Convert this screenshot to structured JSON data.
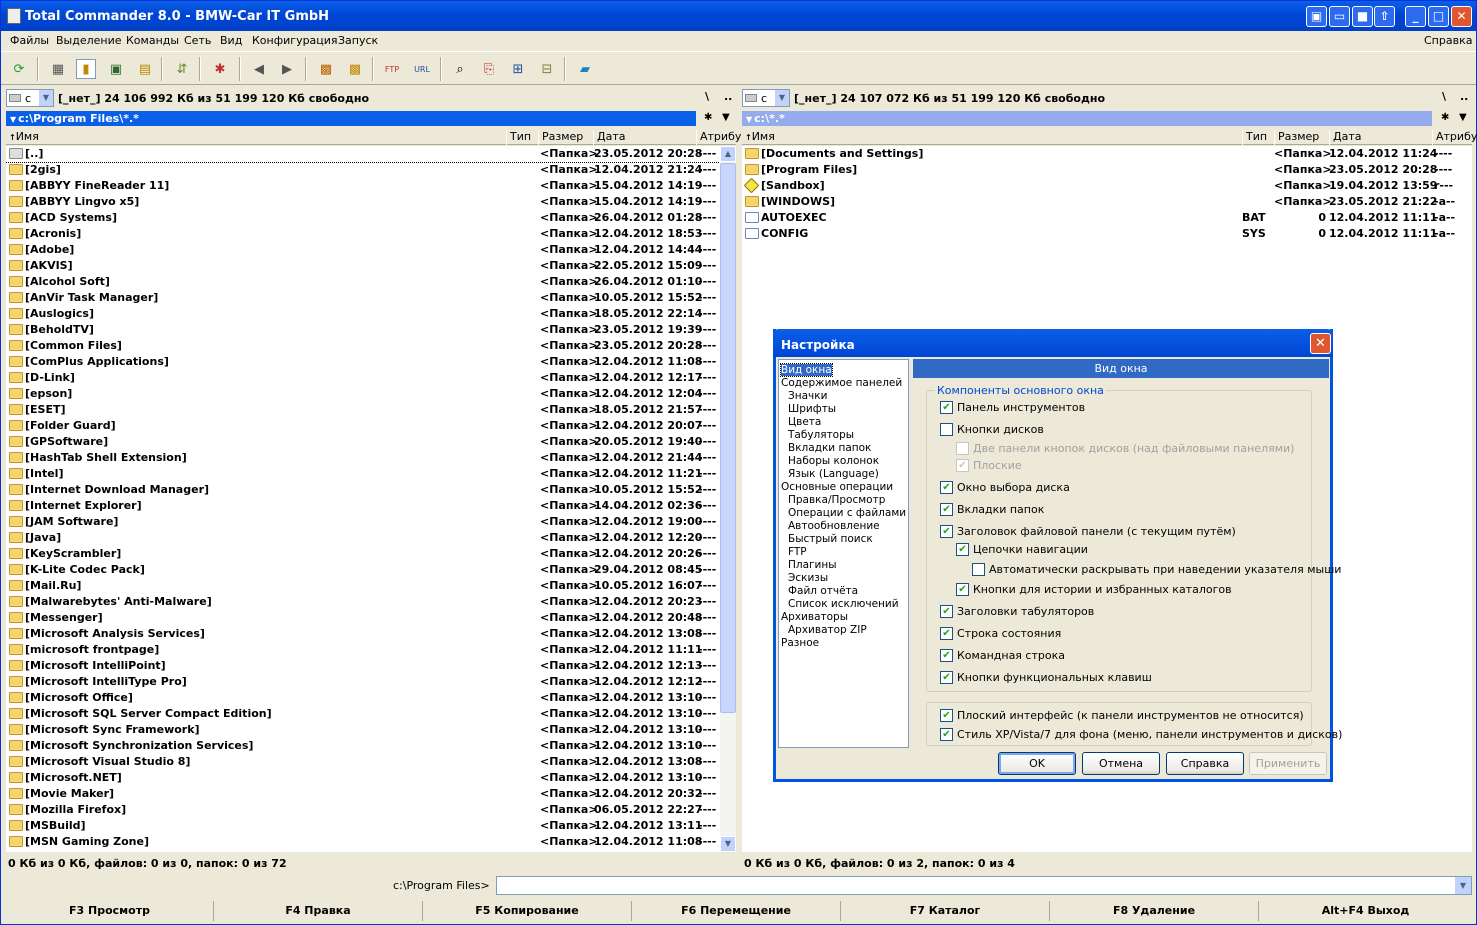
{
  "window": {
    "title": "Total Commander 8.0 - BMW-Car IT GmbH"
  },
  "menu": {
    "items": [
      "Файлы",
      "Выделение",
      "Команды",
      "Сеть",
      "Вид",
      "Конфигурация",
      "Запуск"
    ],
    "help": "Справка"
  },
  "left": {
    "drive": "c",
    "drive_info": "[_нет_]  24 106 992 Кб из 51 199 120 Кб свободно",
    "path": "c:\\Program Files\\*.*",
    "columns": [
      "Имя",
      "Тип",
      "Размер",
      "Дата",
      "Атрибу"
    ],
    "files": [
      {
        "name": "[..]",
        "size": "<Папка>",
        "date": "23.05.2012 20:28",
        "attr": "----"
      },
      {
        "name": "[2gis]",
        "size": "<Папка>",
        "date": "12.04.2012 21:24",
        "attr": "----"
      },
      {
        "name": "[ABBYY FineReader 11]",
        "size": "<Папка>",
        "date": "15.04.2012 14:19",
        "attr": "----"
      },
      {
        "name": "[ABBYY Lingvo x5]",
        "size": "<Папка>",
        "date": "15.04.2012 14:19",
        "attr": "----"
      },
      {
        "name": "[ACD Systems]",
        "size": "<Папка>",
        "date": "26.04.2012 01:28",
        "attr": "----"
      },
      {
        "name": "[Acronis]",
        "size": "<Папка>",
        "date": "12.04.2012 18:53",
        "attr": "----"
      },
      {
        "name": "[Adobe]",
        "size": "<Папка>",
        "date": "12.04.2012 14:44",
        "attr": "----"
      },
      {
        "name": "[AKVIS]",
        "size": "<Папка>",
        "date": "22.05.2012 15:09",
        "attr": "----"
      },
      {
        "name": "[Alcohol Soft]",
        "size": "<Папка>",
        "date": "26.04.2012 01:10",
        "attr": "----"
      },
      {
        "name": "[AnVir Task Manager]",
        "size": "<Папка>",
        "date": "10.05.2012 15:52",
        "attr": "----"
      },
      {
        "name": "[Auslogics]",
        "size": "<Папка>",
        "date": "18.05.2012 22:14",
        "attr": "----"
      },
      {
        "name": "[BeholdTV]",
        "size": "<Папка>",
        "date": "23.05.2012 19:39",
        "attr": "----"
      },
      {
        "name": "[Common Files]",
        "size": "<Папка>",
        "date": "23.05.2012 20:28",
        "attr": "----"
      },
      {
        "name": "[ComPlus Applications]",
        "size": "<Папка>",
        "date": "12.04.2012 11:08",
        "attr": "----"
      },
      {
        "name": "[D-Link]",
        "size": "<Папка>",
        "date": "12.04.2012 12:17",
        "attr": "----"
      },
      {
        "name": "[epson]",
        "size": "<Папка>",
        "date": "12.04.2012 12:04",
        "attr": "----"
      },
      {
        "name": "[ESET]",
        "size": "<Папка>",
        "date": "18.05.2012 21:57",
        "attr": "----"
      },
      {
        "name": "[Folder Guard]",
        "size": "<Папка>",
        "date": "12.04.2012 20:07",
        "attr": "----"
      },
      {
        "name": "[GPSoftware]",
        "size": "<Папка>",
        "date": "20.05.2012 19:40",
        "attr": "----"
      },
      {
        "name": "[HashTab Shell Extension]",
        "size": "<Папка>",
        "date": "12.04.2012 21:44",
        "attr": "----"
      },
      {
        "name": "[Intel]",
        "size": "<Папка>",
        "date": "12.04.2012 11:21",
        "attr": "----"
      },
      {
        "name": "[Internet Download Manager]",
        "size": "<Папка>",
        "date": "10.05.2012 15:52",
        "attr": "----"
      },
      {
        "name": "[Internet Explorer]",
        "size": "<Папка>",
        "date": "14.04.2012 02:36",
        "attr": "----"
      },
      {
        "name": "[JAM Software]",
        "size": "<Папка>",
        "date": "12.04.2012 19:00",
        "attr": "----"
      },
      {
        "name": "[Java]",
        "size": "<Папка>",
        "date": "12.04.2012 12:20",
        "attr": "----"
      },
      {
        "name": "[KeyScrambler]",
        "size": "<Папка>",
        "date": "12.04.2012 20:26",
        "attr": "----"
      },
      {
        "name": "[K-Lite Codec Pack]",
        "size": "<Папка>",
        "date": "29.04.2012 08:45",
        "attr": "----"
      },
      {
        "name": "[Mail.Ru]",
        "size": "<Папка>",
        "date": "10.05.2012 16:07",
        "attr": "----"
      },
      {
        "name": "[Malwarebytes' Anti-Malware]",
        "size": "<Папка>",
        "date": "12.04.2012 20:23",
        "attr": "----"
      },
      {
        "name": "[Messenger]",
        "size": "<Папка>",
        "date": "12.04.2012 20:48",
        "attr": "----"
      },
      {
        "name": "[Microsoft Analysis Services]",
        "size": "<Папка>",
        "date": "12.04.2012 13:08",
        "attr": "----"
      },
      {
        "name": "[microsoft frontpage]",
        "size": "<Папка>",
        "date": "12.04.2012 11:11",
        "attr": "----"
      },
      {
        "name": "[Microsoft IntelliPoint]",
        "size": "<Папка>",
        "date": "12.04.2012 12:13",
        "attr": "----"
      },
      {
        "name": "[Microsoft IntelliType Pro]",
        "size": "<Папка>",
        "date": "12.04.2012 12:12",
        "attr": "----"
      },
      {
        "name": "[Microsoft Office]",
        "size": "<Папка>",
        "date": "12.04.2012 13:10",
        "attr": "----"
      },
      {
        "name": "[Microsoft SQL Server Compact Edition]",
        "size": "<Папка>",
        "date": "12.04.2012 13:10",
        "attr": "----"
      },
      {
        "name": "[Microsoft Sync Framework]",
        "size": "<Папка>",
        "date": "12.04.2012 13:10",
        "attr": "----"
      },
      {
        "name": "[Microsoft Synchronization Services]",
        "size": "<Папка>",
        "date": "12.04.2012 13:10",
        "attr": "----"
      },
      {
        "name": "[Microsoft Visual Studio 8]",
        "size": "<Папка>",
        "date": "12.04.2012 13:08",
        "attr": "----"
      },
      {
        "name": "[Microsoft.NET]",
        "size": "<Папка>",
        "date": "12.04.2012 13:10",
        "attr": "----"
      },
      {
        "name": "[Movie Maker]",
        "size": "<Папка>",
        "date": "12.04.2012 20:32",
        "attr": "----"
      },
      {
        "name": "[Mozilla Firefox]",
        "size": "<Папка>",
        "date": "06.05.2012 22:27",
        "attr": "----"
      },
      {
        "name": "[MSBuild]",
        "size": "<Папка>",
        "date": "12.04.2012 13:11",
        "attr": "----"
      },
      {
        "name": "[MSN Gaming Zone]",
        "size": "<Папка>",
        "date": "12.04.2012 11:08",
        "attr": "----"
      }
    ],
    "status": "0 Кб из 0 Кб, файлов: 0 из 0, папок: 0 из 72"
  },
  "right": {
    "drive": "c",
    "drive_info": "[_нет_]  24 107 072 Кб из 51 199 120 Кб свободно",
    "path": "c:\\*.*",
    "columns": [
      "Имя",
      "Тип",
      "Размер",
      "Дата",
      "Атрибу"
    ],
    "files": [
      {
        "name": "[Documents and Settings]",
        "ext": "",
        "size": "<Папка>",
        "date": "12.04.2012 11:24",
        "attr": "----",
        "kind": "folder"
      },
      {
        "name": "[Program Files]",
        "ext": "",
        "size": "<Папка>",
        "date": "23.05.2012 20:28",
        "attr": "----",
        "kind": "folder"
      },
      {
        "name": "[Sandbox]",
        "ext": "",
        "size": "<Папка>",
        "date": "19.04.2012 13:59",
        "attr": "r---",
        "kind": "sandbox"
      },
      {
        "name": "[WINDOWS]",
        "ext": "",
        "size": "<Папка>",
        "date": "23.05.2012 21:22",
        "attr": "-a--",
        "kind": "folder"
      },
      {
        "name": "AUTOEXEC",
        "ext": "BAT",
        "size": "0",
        "date": "12.04.2012 11:11",
        "attr": "-a--",
        "kind": "file"
      },
      {
        "name": "CONFIG",
        "ext": "SYS",
        "size": "0",
        "date": "12.04.2012 11:11",
        "attr": "-a--",
        "kind": "file"
      }
    ],
    "status": "0 Кб из 0 Кб, файлов: 0 из 2, папок: 0 из 4"
  },
  "cmdline": {
    "prompt": "c:\\Program Files>",
    "value": ""
  },
  "fkeys": [
    "F3 Просмотр",
    "F4 Правка",
    "F5 Копирование",
    "F6 Перемещение",
    "F7 Каталог",
    "F8 Удаление",
    "Alt+F4 Выход"
  ],
  "dialog": {
    "title": "Настройка",
    "panel_title": "Вид окна",
    "tree": [
      {
        "label": "Вид окна",
        "level": 0,
        "selected": true
      },
      {
        "label": "Содержимое панелей",
        "level": 0
      },
      {
        "label": "Значки",
        "level": 1
      },
      {
        "label": "Шрифты",
        "level": 1
      },
      {
        "label": "Цвета",
        "level": 1
      },
      {
        "label": "Табуляторы",
        "level": 1
      },
      {
        "label": "Вкладки папок",
        "level": 1
      },
      {
        "label": "Наборы колонок",
        "level": 1
      },
      {
        "label": "Язык (Language)",
        "level": 1
      },
      {
        "label": "Основные операции",
        "level": 0
      },
      {
        "label": "Правка/Просмотр",
        "level": 1
      },
      {
        "label": "Операции с файлами",
        "level": 1
      },
      {
        "label": "Автообновление",
        "level": 1
      },
      {
        "label": "Быстрый поиск",
        "level": 1
      },
      {
        "label": "FTP",
        "level": 1
      },
      {
        "label": "Плагины",
        "level": 1
      },
      {
        "label": "Эскизы",
        "level": 1
      },
      {
        "label": "Файл отчёта",
        "level": 1
      },
      {
        "label": "Список исключений",
        "level": 1
      },
      {
        "label": "Архиваторы",
        "level": 0
      },
      {
        "label": "Архиватор ZIP",
        "level": 1
      },
      {
        "label": "Разное",
        "level": 0
      }
    ],
    "group_label": "Компоненты основного окна",
    "options": [
      {
        "label": "Панель инструментов",
        "checked": true
      },
      {
        "label": "Кнопки дисков",
        "checked": false
      },
      {
        "label": "Две панели кнопок дисков (над файловыми панелями)",
        "checked": false,
        "disabled": true
      },
      {
        "label": "Плоские",
        "checked": true,
        "disabled": true
      },
      {
        "label": "Окно выбора диска",
        "checked": true
      },
      {
        "label": "Вкладки папок",
        "checked": true
      },
      {
        "label": "Заголовок файловой панели (с текущим путём)",
        "checked": true
      },
      {
        "label": "Цепочки навигации",
        "checked": true
      },
      {
        "label": "Автоматически раскрывать при наведении указателя мыши",
        "checked": false
      },
      {
        "label": "Кнопки для истории и избранных каталогов",
        "checked": true
      },
      {
        "label": "Заголовки табуляторов",
        "checked": true
      },
      {
        "label": "Строка состояния",
        "checked": true
      },
      {
        "label": "Командная строка",
        "checked": true
      },
      {
        "label": "Кнопки функциональных клавиш",
        "checked": true
      },
      {
        "label": "Плоский интерфейс (к панели инструментов не относится)",
        "checked": true
      },
      {
        "label": "Стиль XP/Vista/7 для фона (меню, панели инструментов и дисков)",
        "checked": true
      }
    ],
    "buttons": {
      "ok": "OK",
      "cancel": "Отмена",
      "help": "Справка",
      "apply": "Применить"
    }
  },
  "colors": {
    "active_path": "#0A5FE8",
    "inactive_path": "#94ACEE",
    "selection": "#316AC5"
  }
}
